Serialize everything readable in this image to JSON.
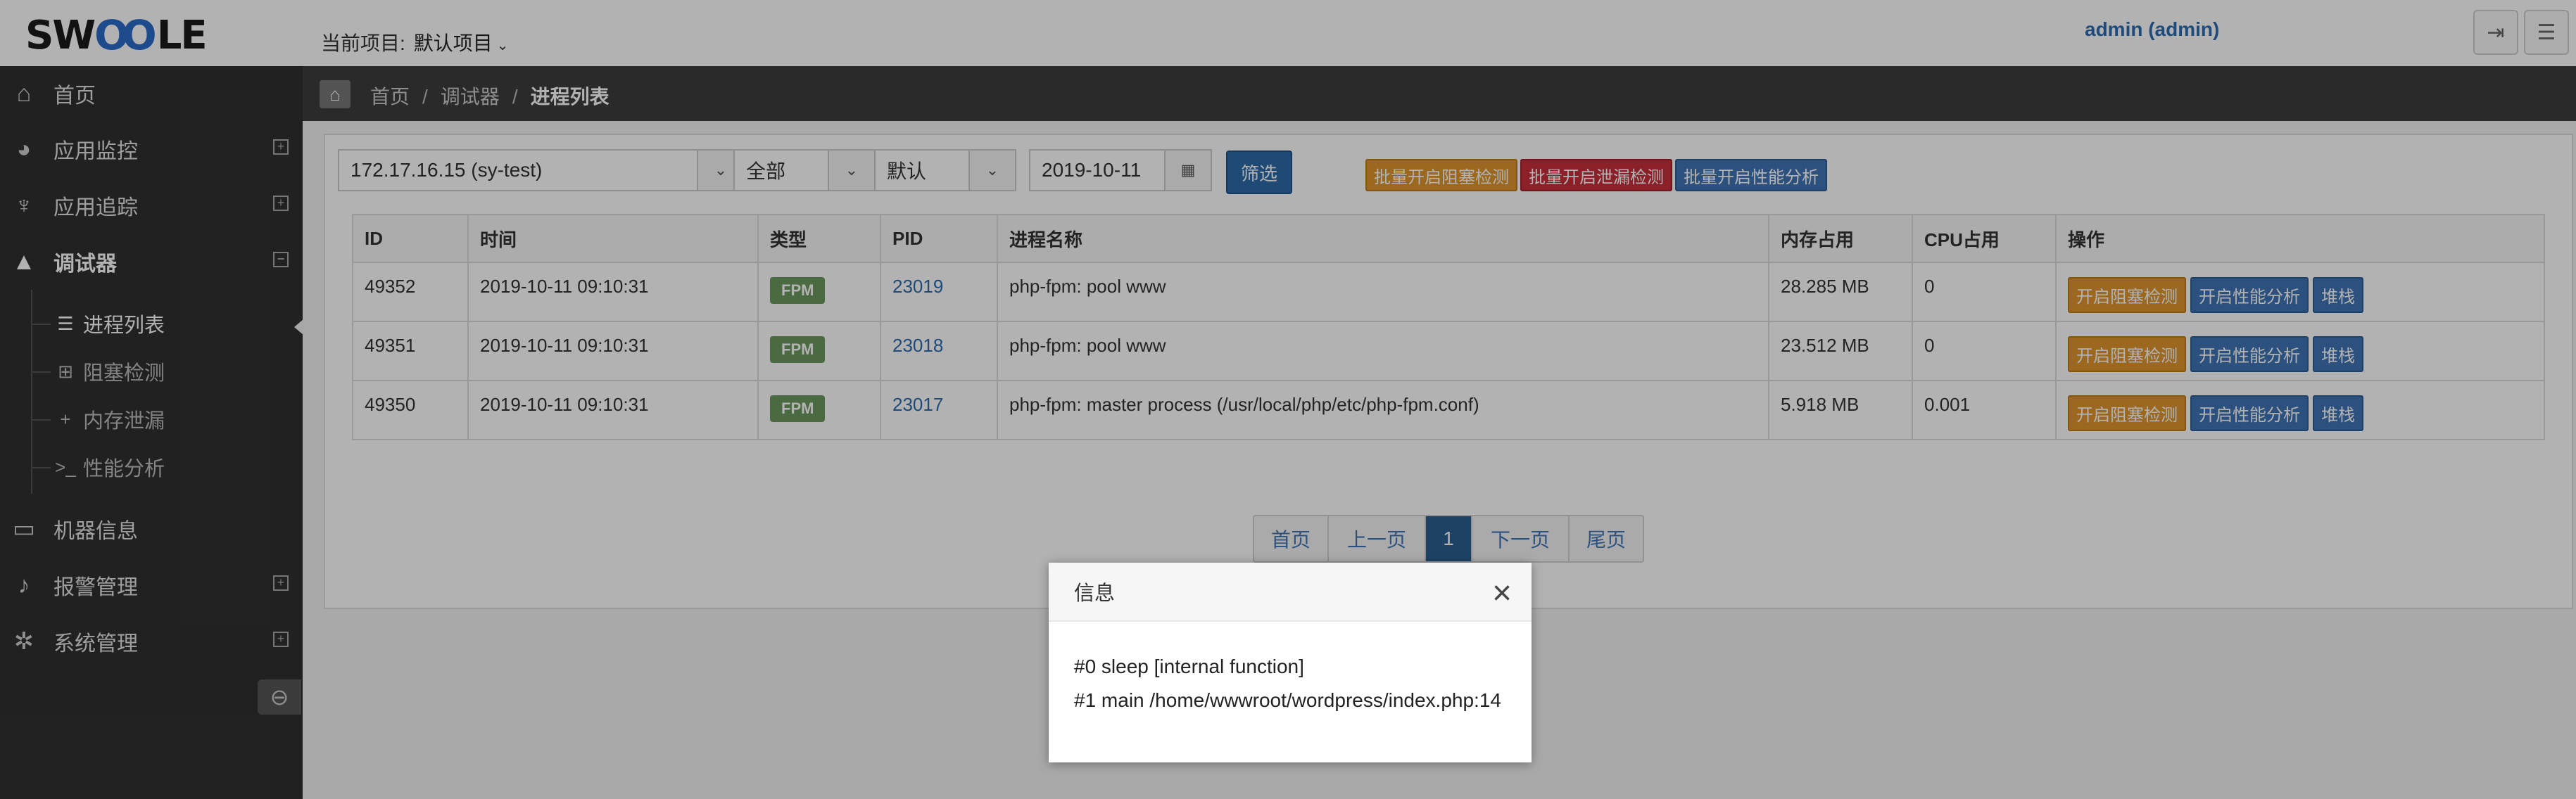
{
  "header": {
    "logo_text": "SW",
    "logo_oo": "OO",
    "logo_tail": "LE",
    "project_label": "当前项目:",
    "project_value": "默认项目",
    "user": "admin (admin)"
  },
  "sidebar": {
    "items": [
      {
        "label": "首页",
        "icon": "home-icon",
        "glyph": "⌂"
      },
      {
        "label": "应用监控",
        "icon": "dashboard-icon",
        "glyph": "◕"
      },
      {
        "label": "应用追踪",
        "icon": "stethoscope-icon",
        "glyph": "♆"
      },
      {
        "label": "调试器",
        "icon": "warning-icon",
        "glyph": "▲"
      },
      {
        "label": "机器信息",
        "icon": "desktop-icon",
        "glyph": "▭"
      },
      {
        "label": "报警管理",
        "icon": "bell-icon",
        "glyph": "♪"
      },
      {
        "label": "系统管理",
        "icon": "cog-icon",
        "glyph": "✲"
      }
    ],
    "sub_items": [
      {
        "label": "进程列表",
        "icon": "list-icon",
        "glyph": "☰"
      },
      {
        "label": "阻塞检测",
        "icon": "plus-square-icon",
        "glyph": "⊞"
      },
      {
        "label": "内存泄漏",
        "icon": "plus-icon",
        "glyph": "+"
      },
      {
        "label": "性能分析",
        "icon": "terminal-icon",
        "glyph": ">_"
      }
    ]
  },
  "breadcrumb": {
    "home": "首页",
    "debugger": "调试器",
    "current": "进程列表"
  },
  "filters": {
    "host": "172.17.16.15 (sy-test)",
    "type": "全部",
    "order": "默认",
    "date": "2019-10-11",
    "filter_button": "筛选",
    "batch_block": "批量开启阻塞检测",
    "batch_leak": "批量开启泄漏检测",
    "batch_perf": "批量开启性能分析"
  },
  "table": {
    "headers": [
      "ID",
      "时间",
      "类型",
      "PID",
      "进程名称",
      "内存占用",
      "CPU占用",
      "操作"
    ],
    "rows": [
      {
        "id": "49352",
        "time": "2019-10-11 09:10:31",
        "type": "FPM",
        "pid": "23019",
        "name": "php-fpm: pool www",
        "mem": "28.285 MB",
        "cpu": "0"
      },
      {
        "id": "49351",
        "time": "2019-10-11 09:10:31",
        "type": "FPM",
        "pid": "23018",
        "name": "php-fpm: pool www",
        "mem": "23.512 MB",
        "cpu": "0"
      },
      {
        "id": "49350",
        "time": "2019-10-11 09:10:31",
        "type": "FPM",
        "pid": "23017",
        "name": "php-fpm: master process (/usr/local/php/etc/php-fpm.conf)",
        "mem": "5.918 MB",
        "cpu": "0.001"
      }
    ],
    "action_block": "开启阻塞检测",
    "action_perf": "开启性能分析",
    "action_stack": "堆栈"
  },
  "pagination": {
    "first": "首页",
    "prev": "上一页",
    "current": "1",
    "next": "下一页",
    "last": "尾页"
  },
  "modal": {
    "title": "信息",
    "close": "×",
    "line1": "#0 sleep [internal function]",
    "line2": "#1 main /home/wwwroot/wordpress/index.php:14"
  },
  "colors": {
    "sidebar_bg": "#303030",
    "breadcrumb_bg": "#3d3d3d",
    "accent_blue": "#2c6aa8",
    "orange": "#e0962e",
    "red": "#c72f3a",
    "badge_green": "#6a9a5d"
  }
}
